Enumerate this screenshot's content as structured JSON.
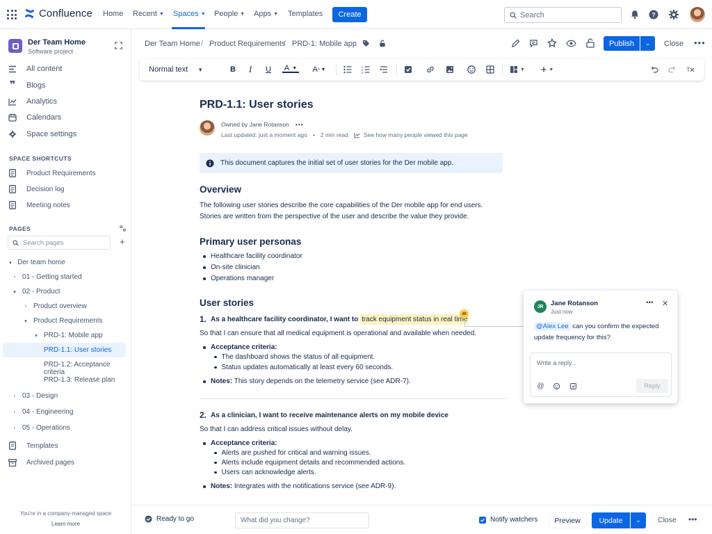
{
  "topnav": {
    "app_name": "Confluence",
    "items": [
      {
        "label": "Home"
      },
      {
        "label": "Recent"
      },
      {
        "label": "Spaces"
      },
      {
        "label": "People"
      },
      {
        "label": "Apps"
      },
      {
        "label": "Templates"
      }
    ],
    "create_label": "Create",
    "search_placeholder": "Search",
    "accent_color": "#0c66e4"
  },
  "sidebar": {
    "space_title": "Der Team Home",
    "space_subtitle": "Software project",
    "main_items": [
      {
        "label": "All content",
        "icon": "list-icon"
      },
      {
        "label": "Blogs",
        "icon": "quote-icon"
      },
      {
        "label": "Analytics",
        "icon": "chart-icon"
      },
      {
        "label": "Calendars",
        "icon": "calendar-icon"
      },
      {
        "label": "Space settings",
        "icon": "gear-icon"
      }
    ],
    "shortcuts_heading": "SPACE SHORTCUTS",
    "shortcuts": [
      {
        "label": "Product Requirements"
      },
      {
        "label": "Decision log"
      },
      {
        "label": "Meeting notes"
      }
    ],
    "pages_heading": "PAGES",
    "search_pages_placeholder": "Search pages",
    "tree": [
      {
        "label": "Der team home"
      },
      {
        "label": "01 - Getting started"
      },
      {
        "label": "02 - Product"
      },
      {
        "label": "Product overview"
      },
      {
        "label": "Product Requirements"
      },
      {
        "label": "PRD-1: Mobile app"
      },
      {
        "label": "PRD-1.1: User stories"
      },
      {
        "label": "PRD-1.2: Acceptance criteria"
      },
      {
        "label": "PRD-1.3: Release plan"
      },
      {
        "label": "03 - Design"
      },
      {
        "label": "04 - Engineering"
      },
      {
        "label": "05 - Operations"
      }
    ],
    "bottom_items": [
      {
        "label": "Templates"
      },
      {
        "label": "Archived pages"
      }
    ],
    "footer_text": "You're in a company-managed space",
    "footer_link": "Learn more"
  },
  "breadcrumb": {
    "items": [
      "Der Team Home",
      "Product Requirements",
      "PRD-1: Mobile app"
    ],
    "publish_label": "Publish",
    "close_label": "Close"
  },
  "toolbar": {
    "text_style": "Normal text"
  },
  "document": {
    "title": "PRD-1.1: User stories",
    "owned_by": "Owned by Jane Rotanson",
    "last_updated": "Last updated: just a moment ago",
    "read_time": "2 min read",
    "views_link": "See how many people viewed this page",
    "info_text": "This document captures the initial set of user stories for the Der mobile app.",
    "overview_heading": "Overview",
    "overview_line1": "The following user stories describe the core capabilities of the Der mobile app for end users.",
    "overview_line2": "Stories are written from the perspective of the user and describe the value they provide.",
    "personas_heading": "Primary user personas",
    "personas": [
      "Healthcare facility coordinator",
      "On-site clinician",
      "Operations manager"
    ],
    "stories_heading": "User stories",
    "story1": {
      "number": "1.",
      "lead": "As a healthcare facility coordinator, I want to",
      "highlight": "track equipment status in real time",
      "so_that": "So that I can ensure that all medical equipment is operational and available when needed.",
      "criteria_label": "Acceptance criteria:",
      "criteria": [
        "The dashboard shows the status of all equipment.",
        "Status updates automatically at least every 60 seconds."
      ],
      "notes_label": "Notes:",
      "notes": "This story depends on the telemetry service (see ADR-7)."
    },
    "story2": {
      "number": "2.",
      "lead": "As a clinician, I want to receive maintenance alerts on my mobile device",
      "so_that": "So that I can address critical issues without delay.",
      "criteria_label": "Acceptance criteria:",
      "criteria": [
        "Alerts are pushed for critical and warning issues.",
        "Alerts include equipment details and recommended actions.",
        "Users can acknowledge alerts."
      ],
      "notes_label": "Notes:",
      "notes": "Integrates with the notifications service (see ADR-9)."
    },
    "marker_initials": "JR"
  },
  "comment": {
    "initials": "JR",
    "author": "Jane Rotanson",
    "time": "Just now",
    "mention": "@Alex Lee",
    "text_after_mention": "can you confirm the expected",
    "text_line2": "update frequency for this?",
    "reply_placeholder": "Write a reply...",
    "reply_label": "Reply"
  },
  "bottombar": {
    "ready_text": "Ready to go",
    "change_placeholder": "What did you change?",
    "notify_label": "Notify watchers",
    "preview_label": "Preview",
    "update_label": "Update",
    "close_label": "Close"
  }
}
